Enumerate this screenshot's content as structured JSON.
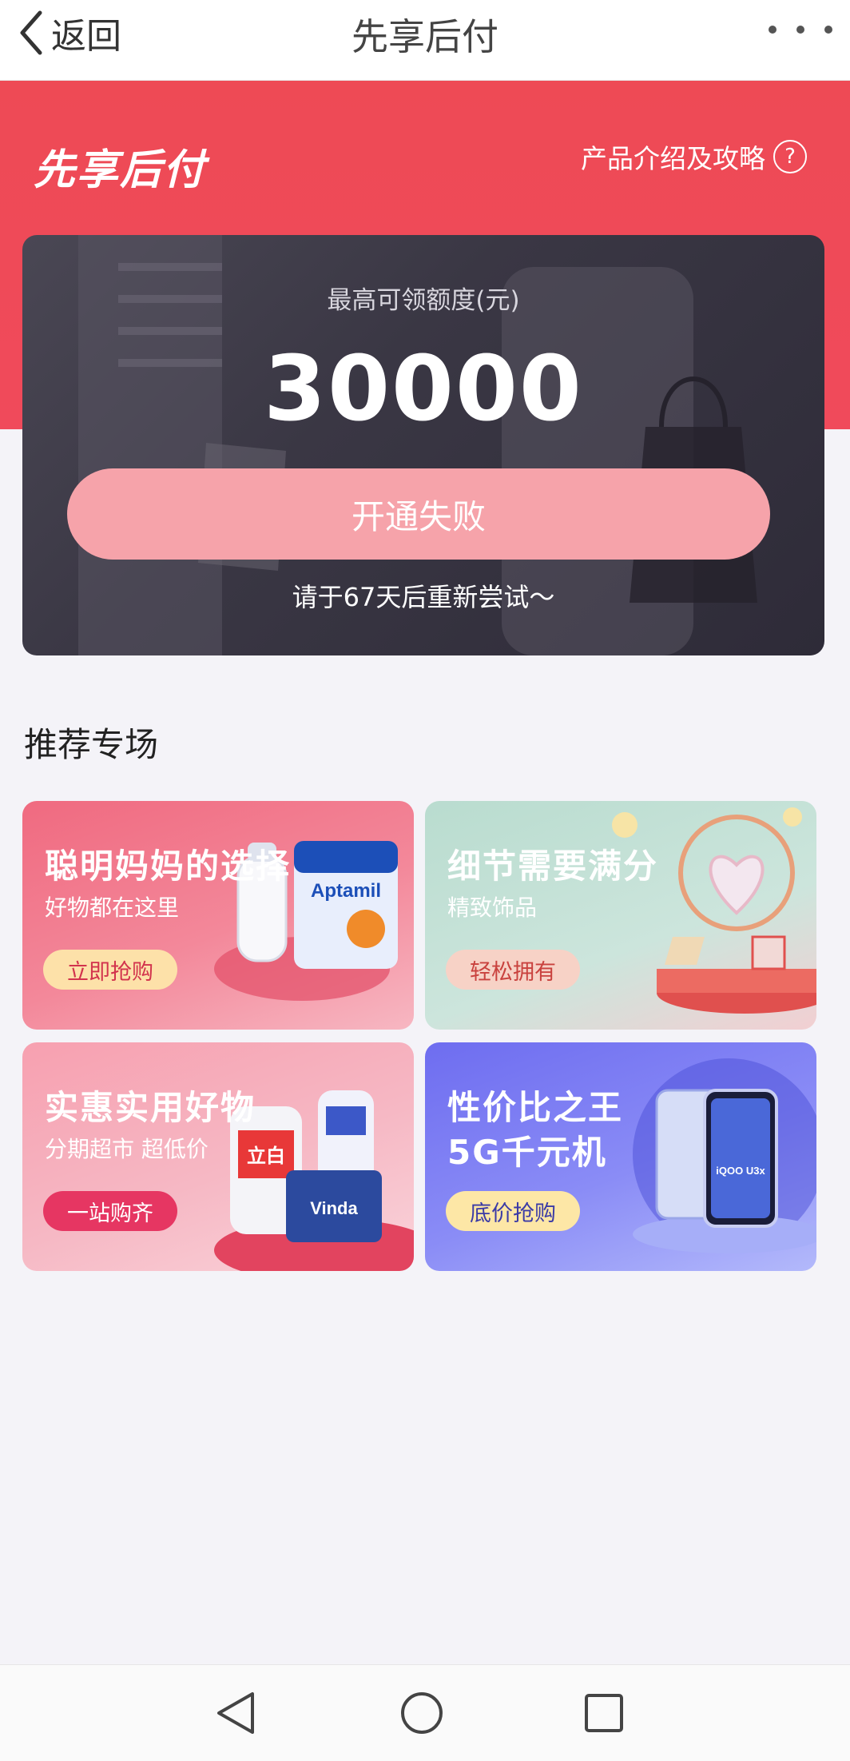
{
  "header": {
    "back_label": "返回",
    "title": "先享后付"
  },
  "hero": {
    "brand": "先享后付",
    "guide_link": "产品介绍及攻略",
    "help_symbol": "?"
  },
  "credit_card": {
    "label": "最高可领额度(元)",
    "amount": "30000",
    "status_button": "开通失败",
    "retry_hint": "请于67天后重新尝试～"
  },
  "recommend": {
    "title": "推荐专场",
    "cards": [
      {
        "title": "聪明妈妈的选择",
        "subtitle": "好物都在这里",
        "button": "立即抢购",
        "product_text": "Aptamil",
        "accent": "#f06a80"
      },
      {
        "title": "细节需要满分",
        "subtitle": "精致饰品",
        "button": "轻松拥有",
        "accent": "#b9dccf"
      },
      {
        "title": "实惠实用好物",
        "subtitle": "分期超市  超低价",
        "button": "一站购齐",
        "product_text": "Vinda",
        "product_text_2": "立白",
        "accent": "#f7a0b0"
      },
      {
        "title": "性价比之王",
        "title_line2": "5G千元机",
        "button": "底价抢购",
        "product_text": "iQOO U3x",
        "accent": "#6e6df0"
      }
    ]
  },
  "system_nav": {
    "icons": [
      "back-triangle-icon",
      "home-circle-icon",
      "recents-square-icon"
    ]
  }
}
